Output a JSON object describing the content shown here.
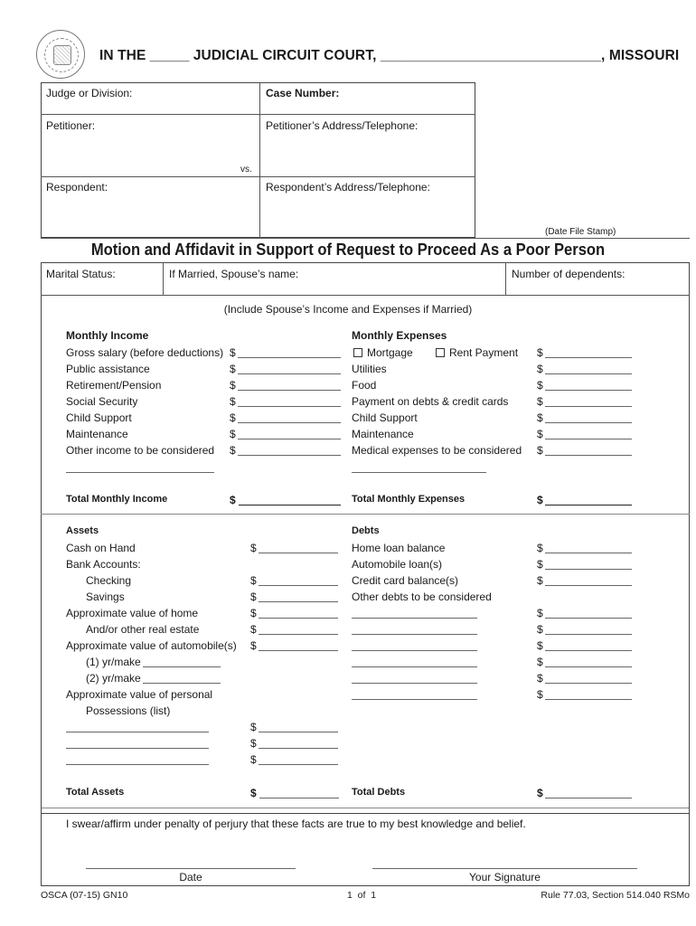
{
  "header": {
    "court_title": "IN THE _____ JUDICIAL CIRCUIT COURT, ____________________________, MISSOURI"
  },
  "caption": {
    "judge_label": "Judge or Division:",
    "case_number_label": "Case Number:",
    "petitioner_label": "Petitioner:",
    "petitioner_address_label": "Petitioner’s Address/Telephone:",
    "vs_label": "vs.",
    "respondent_label": "Respondent:",
    "respondent_address_label": "Respondent’s Address/Telephone:",
    "date_file_stamp": "(Date File Stamp)"
  },
  "form_title": "Motion and Affidavit in Support of Request to Proceed As a Poor Person",
  "personal": {
    "marital_status_label": "Marital Status:",
    "spouse_name_label": "If Married, Spouse’s name:",
    "dependents_label": "Number of dependents:",
    "include_note": "(Include Spouse’s Income and Expenses if Married)"
  },
  "income": {
    "heading": "Monthly Income",
    "items": [
      "Gross salary (before deductions)",
      "Public assistance",
      "Retirement/Pension",
      "Social Security",
      "Child Support",
      "Maintenance",
      "Other income to be considered"
    ],
    "total_label": "Total Monthly Income"
  },
  "expenses": {
    "heading": "Monthly Expenses",
    "mortgage_label": "Mortgage",
    "rent_label": "Rent Payment",
    "items": [
      "Utilities",
      "Food",
      "Payment on debts & credit cards",
      "Child Support",
      "Maintenance",
      "Medical expenses to be considered"
    ],
    "total_label": "Total Monthly Expenses"
  },
  "assets": {
    "heading": "Assets",
    "cash": "Cash on Hand",
    "bank_accounts": "Bank Accounts:",
    "checking": "Checking",
    "savings": "Savings",
    "home": "Approximate value of home",
    "real_estate": "And/or other real estate",
    "automobile": "Approximate value of automobile(s)",
    "auto1": "(1) yr/make",
    "auto2": "(2) yr/make",
    "personal": "Approximate value of personal",
    "possessions": "Possessions (list)",
    "total_label": "Total Assets"
  },
  "debts": {
    "heading": "Debts",
    "home_loan": "Home loan balance",
    "auto_loan": "Automobile loan(s)",
    "credit_card": "Credit card balance(s)",
    "other": "Other debts to be considered",
    "total_label": "Total Debts"
  },
  "currency_symbol": "$",
  "oath": {
    "statement": "I swear/affirm under penalty of perjury that these facts are true to my best knowledge and belief.",
    "date_label": "Date",
    "signature_label": "Your Signature"
  },
  "footer": {
    "form_id": "OSCA (07-15) GN10",
    "page": "1  of  1",
    "rule": "Rule 77.03, Section 514.040 RSMo"
  }
}
